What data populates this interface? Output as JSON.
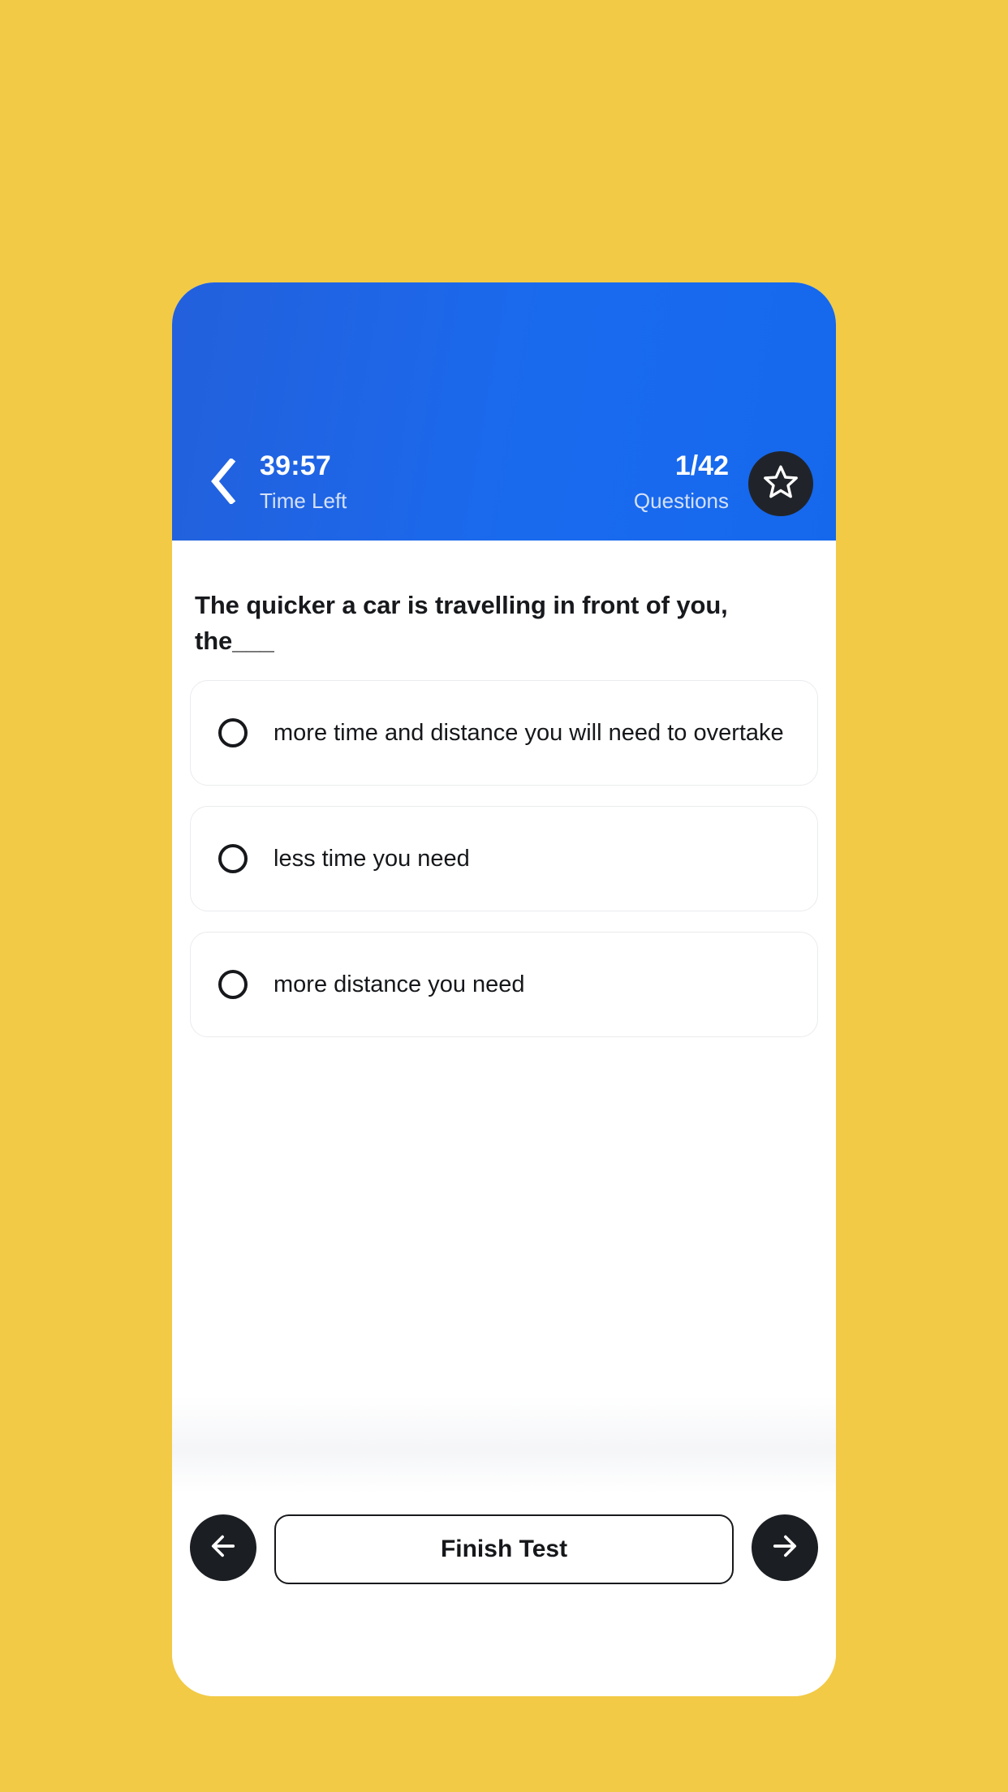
{
  "theme": {
    "page_background": "#F2CA45",
    "header_blue": "#1A65E8",
    "dark_button": "#1B1E22",
    "card_background": "#FFFFFF",
    "muted_text": "#D4E0F8"
  },
  "header": {
    "back_icon": "chevron-left-icon",
    "timer_value": "39:57",
    "timer_label": "Time Left",
    "questions_value": "1/42",
    "questions_label": "Questions",
    "bookmark_icon": "star-outline-icon"
  },
  "question": {
    "text": "The quicker a car is travelling in front of you, the___",
    "options": [
      {
        "label": "more time and distance you will need to overtake",
        "selected": false
      },
      {
        "label": "less time you need",
        "selected": false
      },
      {
        "label": "more distance you need",
        "selected": false
      }
    ]
  },
  "footer": {
    "previous_icon": "arrow-left-icon",
    "finish_label": "Finish Test",
    "next_icon": "arrow-right-icon"
  }
}
